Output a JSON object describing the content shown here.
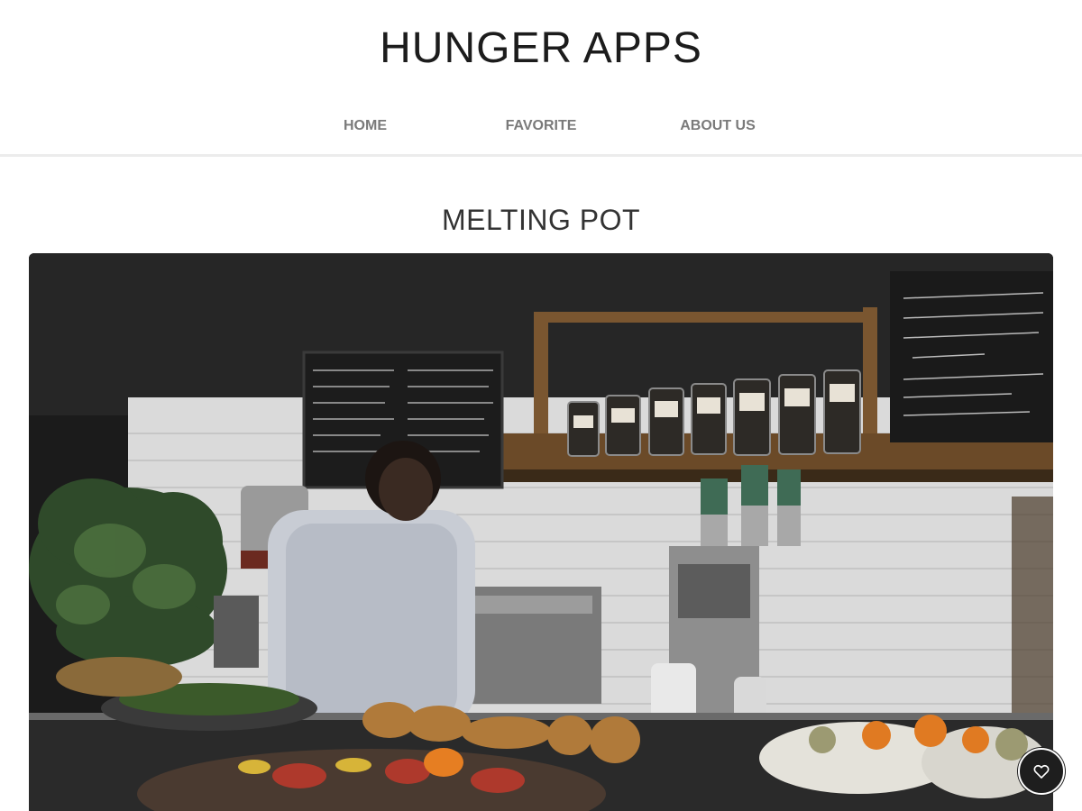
{
  "app": {
    "title": "HUNGER APPS"
  },
  "nav": {
    "items": [
      {
        "label": "HOME"
      },
      {
        "label": "FAVORITE"
      },
      {
        "label": "ABOUT US"
      }
    ]
  },
  "restaurant": {
    "name": "MELTING POT"
  },
  "favorite_button": {
    "icon": "heart-outline-icon"
  },
  "colors": {
    "title_text": "#1c1c1c",
    "nav_text": "#7a7a7a",
    "fav_button_bg": "#1e1e1e"
  }
}
